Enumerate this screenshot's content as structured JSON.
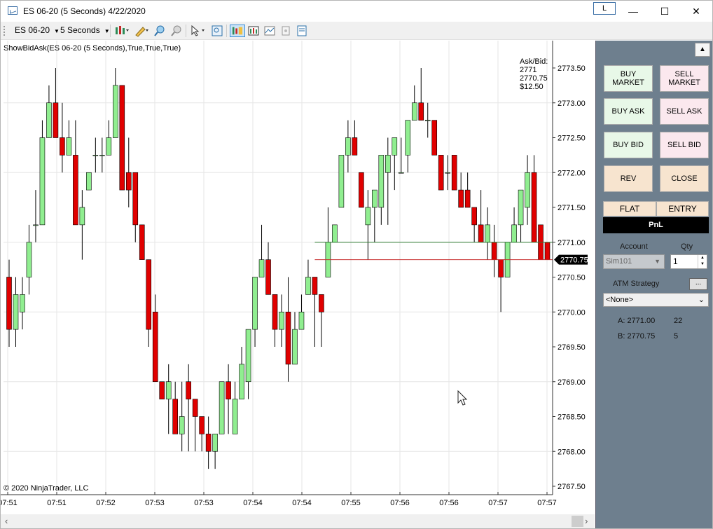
{
  "window": {
    "title": "ES 06-20 (5 Seconds)  4/22/2020",
    "link_button": "L",
    "minimize": "—",
    "maximize": "☐",
    "close": "✕"
  },
  "toolbar": {
    "instrument": "ES 06-20",
    "interval": "5 Seconds",
    "icons": [
      "chart-style-icon",
      "drawing-tool-icon",
      "zoom-in-icon",
      "zoom-out-icon",
      "pointer-icon",
      "magnify-icon",
      "chart-trader-icon",
      "data-box-icon",
      "indicators-icon",
      "strategies-icon",
      "properties-icon"
    ]
  },
  "chart": {
    "indicator_label": "ShowBidAsk(ES 06-20 (5 Seconds),True,True,True)",
    "askbid_title": "Ask/Bid:",
    "ask": "2771",
    "bid": "2770.75",
    "spread_value": "$12.50",
    "last_price_tag": "2770.75",
    "copyright": "© 2020 NinjaTrader, LLC",
    "colors": {
      "up": "#90ee90",
      "down": "#e00000",
      "ask_line": "#2e7d32",
      "bid_line": "#c62828",
      "grid": "#e6e6e6"
    }
  },
  "chart_data": {
    "type": "candlestick",
    "y_ticks": [
      "2773.50",
      "2773.00",
      "2772.50",
      "2772.00",
      "2771.50",
      "2771.00",
      "2770.50",
      "2770.00",
      "2769.50",
      "2769.00",
      "2768.50",
      "2768.00",
      "2767.50"
    ],
    "ylim": [
      2767.5,
      2773.5
    ],
    "x_ticks": [
      "07:51",
      "07:51",
      "07:52",
      "07:53",
      "07:53",
      "07:54",
      "07:54",
      "07:55",
      "07:56",
      "07:56",
      "07:57",
      "07:57"
    ],
    "ask_level": 2771.0,
    "bid_level": 2770.75,
    "candles": [
      {
        "o": 2770.5,
        "h": 2770.75,
        "l": 2769.5,
        "c": 2769.75
      },
      {
        "o": 2769.75,
        "h": 2770.5,
        "l": 2769.5,
        "c": 2770.25
      },
      {
        "o": 2770.0,
        "h": 2770.5,
        "l": 2769.75,
        "c": 2770.25
      },
      {
        "o": 2770.5,
        "h": 2771.25,
        "l": 2770.25,
        "c": 2771.0
      },
      {
        "o": 2771.25,
        "h": 2771.75,
        "l": 2771.0,
        "c": 2771.25
      },
      {
        "o": 2771.25,
        "h": 2772.75,
        "l": 2771.25,
        "c": 2772.5
      },
      {
        "o": 2772.5,
        "h": 2773.25,
        "l": 2772.5,
        "c": 2773.0
      },
      {
        "o": 2773.0,
        "h": 2773.5,
        "l": 2772.5,
        "c": 2772.5
      },
      {
        "o": 2772.5,
        "h": 2773.0,
        "l": 2772.0,
        "c": 2772.25
      },
      {
        "o": 2772.25,
        "h": 2772.75,
        "l": 2772.25,
        "c": 2772.5
      },
      {
        "o": 2772.25,
        "h": 2772.75,
        "l": 2771.25,
        "c": 2771.25
      },
      {
        "o": 2771.25,
        "h": 2771.75,
        "l": 2770.75,
        "c": 2771.5
      },
      {
        "o": 2771.75,
        "h": 2772.0,
        "l": 2771.75,
        "c": 2772.0
      },
      {
        "o": 2772.25,
        "h": 2772.5,
        "l": 2772.0,
        "c": 2772.25
      },
      {
        "o": 2772.25,
        "h": 2772.5,
        "l": 2772.0,
        "c": 2772.25
      },
      {
        "o": 2772.25,
        "h": 2772.75,
        "l": 2772.25,
        "c": 2772.5
      },
      {
        "o": 2772.5,
        "h": 2773.5,
        "l": 2772.5,
        "c": 2773.25
      },
      {
        "o": 2773.25,
        "h": 2773.25,
        "l": 2771.75,
        "c": 2771.75
      },
      {
        "o": 2772.0,
        "h": 2772.5,
        "l": 2771.5,
        "c": 2771.75
      },
      {
        "o": 2772.0,
        "h": 2772.0,
        "l": 2771.0,
        "c": 2771.25
      },
      {
        "o": 2771.25,
        "h": 2771.25,
        "l": 2770.75,
        "c": 2770.75
      },
      {
        "o": 2770.75,
        "h": 2770.75,
        "l": 2769.5,
        "c": 2769.75
      },
      {
        "o": 2770.0,
        "h": 2770.25,
        "l": 2769.0,
        "c": 2769.0
      },
      {
        "o": 2769.0,
        "h": 2769.0,
        "l": 2768.75,
        "c": 2768.75
      },
      {
        "o": 2768.75,
        "h": 2769.25,
        "l": 2768.25,
        "c": 2769.0
      },
      {
        "o": 2768.75,
        "h": 2769.0,
        "l": 2768.25,
        "c": 2768.25
      },
      {
        "o": 2768.25,
        "h": 2769.0,
        "l": 2768.0,
        "c": 2768.5
      },
      {
        "o": 2769.0,
        "h": 2769.25,
        "l": 2768.0,
        "c": 2768.75
      },
      {
        "o": 2768.75,
        "h": 2768.75,
        "l": 2768.0,
        "c": 2768.5
      },
      {
        "o": 2768.5,
        "h": 2768.5,
        "l": 2768.0,
        "c": 2768.25
      },
      {
        "o": 2768.25,
        "h": 2768.5,
        "l": 2767.75,
        "c": 2768.0
      },
      {
        "o": 2768.0,
        "h": 2768.25,
        "l": 2767.75,
        "c": 2768.25
      },
      {
        "o": 2768.25,
        "h": 2769.0,
        "l": 2768.25,
        "c": 2769.0
      },
      {
        "o": 2769.0,
        "h": 2769.25,
        "l": 2768.25,
        "c": 2768.75
      },
      {
        "o": 2768.25,
        "h": 2769.0,
        "l": 2768.25,
        "c": 2768.75
      },
      {
        "o": 2768.75,
        "h": 2769.5,
        "l": 2768.75,
        "c": 2769.25
      },
      {
        "o": 2769.0,
        "h": 2769.75,
        "l": 2768.75,
        "c": 2769.75
      },
      {
        "o": 2769.75,
        "h": 2770.5,
        "l": 2769.5,
        "c": 2770.5
      },
      {
        "o": 2770.5,
        "h": 2771.25,
        "l": 2770.5,
        "c": 2770.75
      },
      {
        "o": 2770.75,
        "h": 2771.0,
        "l": 2770.25,
        "c": 2770.25
      },
      {
        "o": 2770.25,
        "h": 2770.25,
        "l": 2769.5,
        "c": 2769.75
      },
      {
        "o": 2769.75,
        "h": 2770.25,
        "l": 2769.5,
        "c": 2770.0
      },
      {
        "o": 2770.0,
        "h": 2770.5,
        "l": 2769.0,
        "c": 2769.25
      },
      {
        "o": 2769.25,
        "h": 2770.0,
        "l": 2769.25,
        "c": 2769.75
      },
      {
        "o": 2769.75,
        "h": 2770.25,
        "l": 2769.75,
        "c": 2770.0
      },
      {
        "o": 2770.25,
        "h": 2770.75,
        "l": 2770.25,
        "c": 2770.5
      },
      {
        "o": 2770.5,
        "h": 2770.5,
        "l": 2769.5,
        "c": 2770.25
      },
      {
        "o": 2770.25,
        "h": 2770.25,
        "l": 2769.5,
        "c": 2770.0
      },
      {
        "o": 2770.5,
        "h": 2771.5,
        "l": 2770.5,
        "c": 2771.0
      },
      {
        "o": 2771.0,
        "h": 2771.25,
        "l": 2771.0,
        "c": 2771.25
      },
      {
        "o": 2771.5,
        "h": 2772.25,
        "l": 2771.5,
        "c": 2772.25
      },
      {
        "o": 2772.25,
        "h": 2772.75,
        "l": 2772.0,
        "c": 2772.5
      },
      {
        "o": 2772.5,
        "h": 2772.75,
        "l": 2772.25,
        "c": 2772.25
      },
      {
        "o": 2772.0,
        "h": 2772.0,
        "l": 2771.5,
        "c": 2771.5
      },
      {
        "o": 2771.25,
        "h": 2771.75,
        "l": 2770.75,
        "c": 2771.5
      },
      {
        "o": 2771.5,
        "h": 2771.75,
        "l": 2771.0,
        "c": 2771.75
      },
      {
        "o": 2771.5,
        "h": 2772.25,
        "l": 2771.25,
        "c": 2772.25
      },
      {
        "o": 2772.0,
        "h": 2772.5,
        "l": 2771.25,
        "c": 2772.25
      },
      {
        "o": 2772.25,
        "h": 2772.5,
        "l": 2771.75,
        "c": 2772.5
      },
      {
        "o": 2772.0,
        "h": 2772.5,
        "l": 2772.0,
        "c": 2772.0
      },
      {
        "o": 2772.25,
        "h": 2772.75,
        "l": 2772.0,
        "c": 2772.75
      },
      {
        "o": 2772.75,
        "h": 2773.25,
        "l": 2772.75,
        "c": 2773.0
      },
      {
        "o": 2773.0,
        "h": 2773.5,
        "l": 2772.75,
        "c": 2772.75
      },
      {
        "o": 2772.75,
        "h": 2773.0,
        "l": 2772.5,
        "c": 2772.75
      },
      {
        "o": 2772.75,
        "h": 2772.75,
        "l": 2772.25,
        "c": 2772.25
      },
      {
        "o": 2772.25,
        "h": 2772.25,
        "l": 2771.75,
        "c": 2771.75
      },
      {
        "o": 2772.0,
        "h": 2772.25,
        "l": 2771.75,
        "c": 2772.0
      },
      {
        "o": 2772.25,
        "h": 2772.25,
        "l": 2771.75,
        "c": 2771.75
      },
      {
        "o": 2771.75,
        "h": 2772.0,
        "l": 2771.5,
        "c": 2771.5
      },
      {
        "o": 2771.75,
        "h": 2772.0,
        "l": 2771.5,
        "c": 2771.5
      },
      {
        "o": 2771.5,
        "h": 2771.5,
        "l": 2771.0,
        "c": 2771.25
      },
      {
        "o": 2771.25,
        "h": 2771.75,
        "l": 2771.0,
        "c": 2771.0
      },
      {
        "o": 2771.0,
        "h": 2771.5,
        "l": 2770.75,
        "c": 2771.25
      },
      {
        "o": 2771.0,
        "h": 2771.25,
        "l": 2770.5,
        "c": 2770.75
      },
      {
        "o": 2770.75,
        "h": 2770.75,
        "l": 2770.0,
        "c": 2770.5
      },
      {
        "o": 2770.5,
        "h": 2771.0,
        "l": 2770.5,
        "c": 2771.0
      },
      {
        "o": 2771.0,
        "h": 2771.5,
        "l": 2771.0,
        "c": 2771.25
      },
      {
        "o": 2771.25,
        "h": 2771.75,
        "l": 2771.0,
        "c": 2771.75
      },
      {
        "o": 2771.5,
        "h": 2772.25,
        "l": 2771.25,
        "c": 2772.0
      },
      {
        "o": 2772.0,
        "h": 2772.25,
        "l": 2771.0,
        "c": 2771.0
      },
      {
        "o": 2771.25,
        "h": 2771.25,
        "l": 2770.75,
        "c": 2770.75
      },
      {
        "o": 2771.0,
        "h": 2771.0,
        "l": 2770.75,
        "c": 2770.75
      }
    ]
  },
  "panel": {
    "collapse": "▲",
    "buy_market": "BUY MARKET",
    "sell_market": "SELL MARKET",
    "buy_ask": "BUY ASK",
    "sell_ask": "SELL ASK",
    "buy_bid": "BUY BID",
    "sell_bid": "SELL BID",
    "rev": "REV",
    "close": "CLOSE",
    "flat": "FLAT",
    "entry": "ENTRY",
    "pnl": "PnL",
    "account_label": "Account",
    "qty_label": "Qty",
    "account_value": "Sim101",
    "qty_value": "1",
    "atm_label": "ATM Strategy",
    "atm_more": "...",
    "atm_value": "<None>",
    "ask_row_label": "A: 2771.00",
    "ask_row_size": "22",
    "bid_row_label": "B: 2770.75",
    "bid_row_size": "5"
  }
}
